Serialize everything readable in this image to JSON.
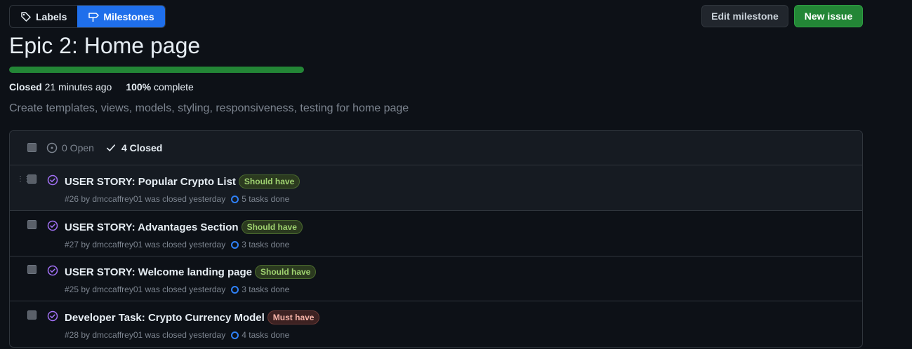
{
  "nav": {
    "labels": "Labels",
    "milestones": "Milestones"
  },
  "actions": {
    "edit_milestone": "Edit milestone",
    "new_issue": "New issue"
  },
  "milestone": {
    "title": "Epic 2: Home page",
    "progress_percent": 100,
    "closed_label": "Closed",
    "closed_time": "21 minutes ago",
    "complete_percent": "100%",
    "complete_label": "complete",
    "description": "Create templates, views, models, styling, responsiveness, testing for home page"
  },
  "list_header": {
    "open_label": "0 Open",
    "closed_label": "4 Closed"
  },
  "issues": [
    {
      "title": "USER STORY: Popular Crypto List",
      "label": "Should have",
      "label_type": "should",
      "meta": "#26 by dmccaffrey01 was closed yesterday",
      "tasks": "5 tasks done"
    },
    {
      "title": "USER STORY: Advantages Section",
      "label": "Should have",
      "label_type": "should",
      "meta": "#27 by dmccaffrey01 was closed yesterday",
      "tasks": "3 tasks done"
    },
    {
      "title": "USER STORY: Welcome landing page",
      "label": "Should have",
      "label_type": "should",
      "meta": "#25 by dmccaffrey01 was closed yesterday",
      "tasks": "3 tasks done"
    },
    {
      "title": "Developer Task: Crypto Currency Model",
      "label": "Must have",
      "label_type": "must",
      "meta": "#28 by dmccaffrey01 was closed yesterday",
      "tasks": "4 tasks done"
    }
  ],
  "colors": {
    "accent": "#1f6feb",
    "success": "#238636",
    "closed_purple": "#a371f7",
    "task_blue": "#2f81f7"
  }
}
